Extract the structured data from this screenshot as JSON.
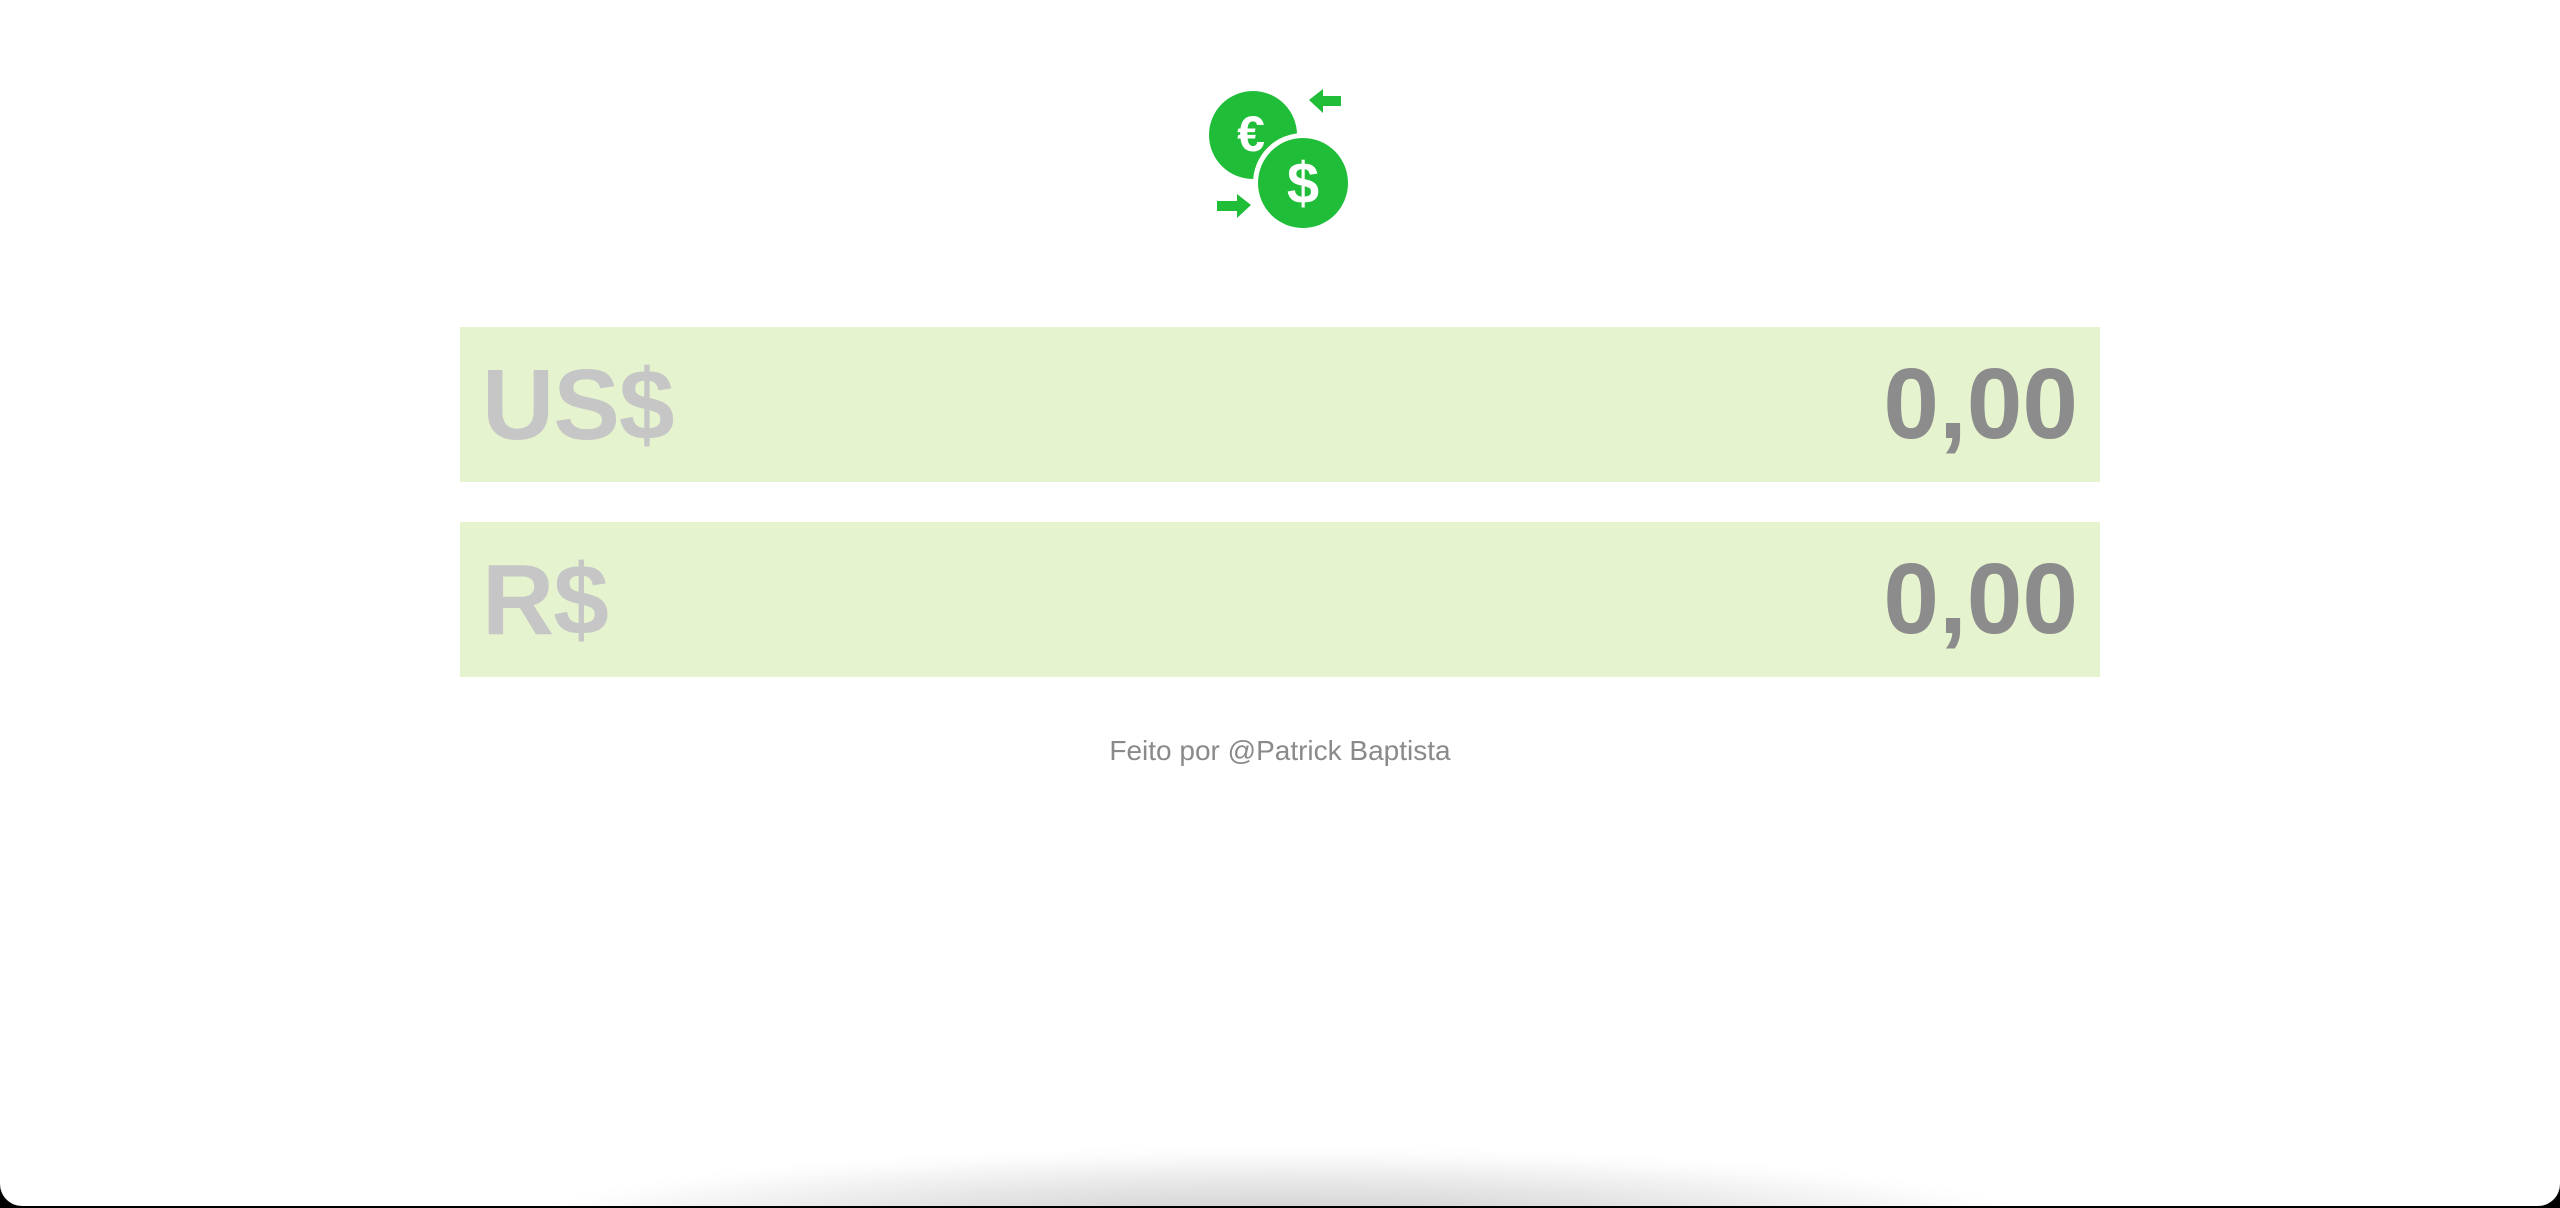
{
  "logo": {
    "icon": "currency-exchange-icon",
    "color": "#1fbd38"
  },
  "converter": {
    "usd": {
      "currency_label": "US$",
      "value": "0,00"
    },
    "brl": {
      "currency_label": "R$",
      "value": "0,00"
    },
    "row_background": "#e6f3cf"
  },
  "footer": {
    "credit": "Feito por @Patrick Baptista"
  }
}
